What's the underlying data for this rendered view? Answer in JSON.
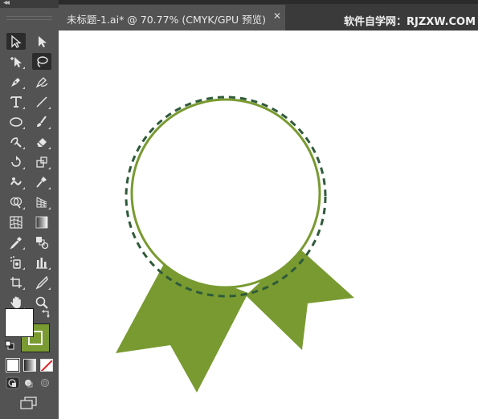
{
  "document_tab": {
    "title": "未标题-1.ai* @ 70.77% (CMYK/GPU 预览)",
    "close_glyph": "✕"
  },
  "watermark": "软件自学网：RJZXW.COM",
  "toolbar": {
    "collapse_glyph": "◂◂",
    "tools": [
      {
        "name": "selection-tool-icon",
        "active": true
      },
      {
        "name": "direct-selection-tool-icon"
      },
      {
        "name": "group-selection-tool-icon"
      },
      {
        "name": "lasso-tool-icon",
        "active": true
      },
      {
        "name": "pen-tool-icon"
      },
      {
        "name": "curvature-tool-icon"
      },
      {
        "name": "type-tool-icon"
      },
      {
        "name": "line-segment-tool-icon"
      },
      {
        "name": "ellipse-tool-icon"
      },
      {
        "name": "paintbrush-tool-icon"
      },
      {
        "name": "shaper-tool-icon"
      },
      {
        "name": "eraser-tool-icon"
      },
      {
        "name": "rotate-tool-icon"
      },
      {
        "name": "scale-tool-icon"
      },
      {
        "name": "warp-tool-icon"
      },
      {
        "name": "puppet-warp-tool-icon"
      },
      {
        "name": "shape-builder-tool-icon"
      },
      {
        "name": "perspective-grid-tool-icon"
      },
      {
        "name": "mesh-tool-icon"
      },
      {
        "name": "gradient-tool-icon"
      },
      {
        "name": "eyedropper-tool-icon"
      },
      {
        "name": "blend-tool-icon"
      },
      {
        "name": "symbol-sprayer-tool-icon"
      },
      {
        "name": "column-graph-tool-icon"
      },
      {
        "name": "artboard-tool-icon"
      },
      {
        "name": "slice-tool-icon"
      },
      {
        "name": "hand-tool-icon"
      },
      {
        "name": "zoom-tool-icon"
      }
    ],
    "fill_color": "#ffffff",
    "stroke_color": "#7a9a32"
  },
  "artwork": {
    "ribbon_color": "#789a30",
    "circle_stroke_color": "#789a30",
    "dashed_ring_color": "#2f5a3a"
  }
}
